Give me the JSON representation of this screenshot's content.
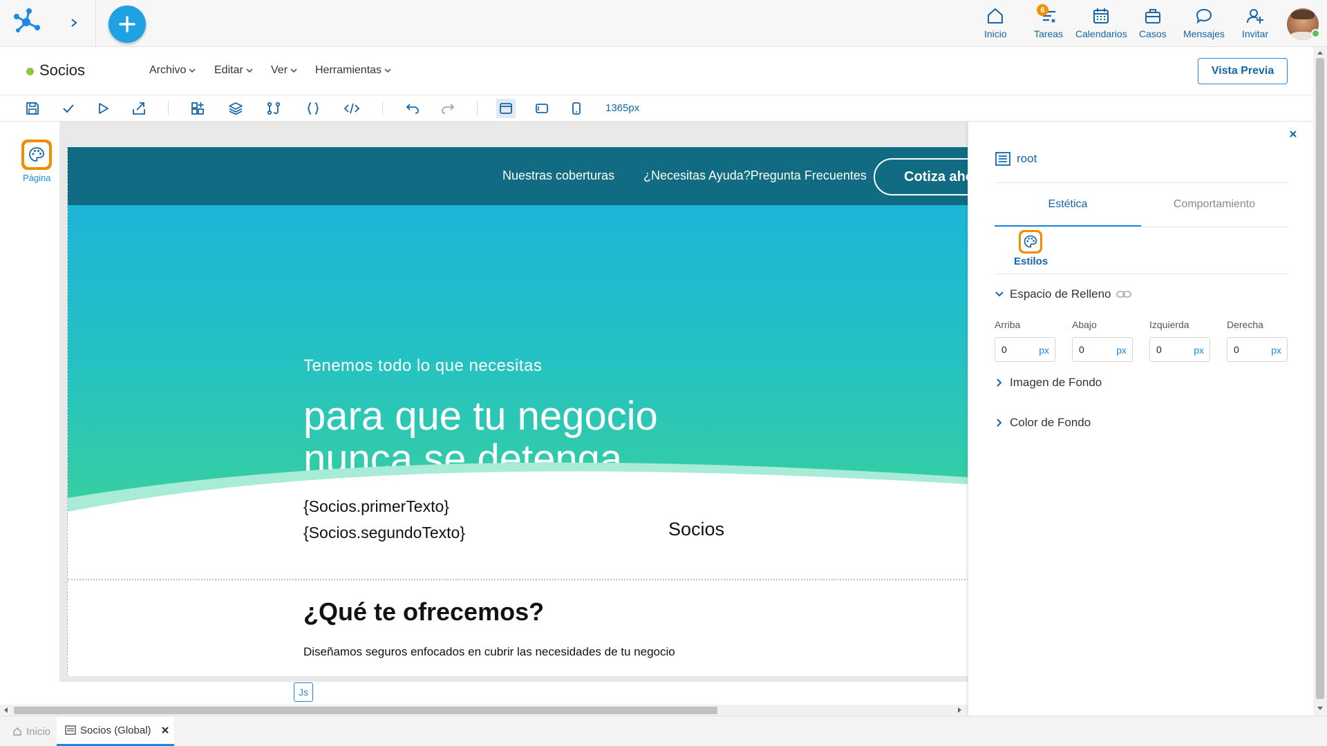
{
  "topbar": {
    "nav": [
      {
        "label": "Inicio",
        "icon": "home-icon"
      },
      {
        "label": "Tareas",
        "icon": "tasks-icon",
        "badge": "6"
      },
      {
        "label": "Calendarios",
        "icon": "calendar-icon"
      },
      {
        "label": "Casos",
        "icon": "briefcase-icon"
      },
      {
        "label": "Mensajes",
        "icon": "chat-icon"
      },
      {
        "label": "Invitar",
        "icon": "add-user-icon"
      }
    ],
    "accent": "#1ea2e4",
    "badge_color": "#f39200"
  },
  "menubar": {
    "title": "Socios",
    "status_color": "#8cc63f",
    "menus": [
      "Archivo",
      "Editar",
      "Ver",
      "Herramientas"
    ],
    "preview_label": "Vista Previa"
  },
  "toolbar": {
    "width_label": "1365px"
  },
  "left_strip": {
    "page_label": "Página"
  },
  "canvas": {
    "nav_links": [
      "Nuestras coberturas",
      "¿Necesitas Ayuda?Pregunta Frecuentes"
    ],
    "cta_label": "Cotiza ahora",
    "hero_subtitle": "Tenemos todo lo que necesitas",
    "hero_title_line1": "para que tu negocio",
    "hero_title_line2": "nunca se detenga",
    "var_text_1": "{Socios.primerTexto}",
    "var_text_2": "{Socios.segundoTexto}",
    "socios_label": "Socios",
    "offer_title": "¿Qué te ofrecemos?",
    "offer_desc": "Diseñamos seguros enfocados en cubrir las necesidades de tu negocio",
    "js_label": "Js",
    "nav_color": "#116b82"
  },
  "panel": {
    "root_label": "root",
    "tabs": [
      "Estética",
      "Comportamiento"
    ],
    "styles_label": "Estilos",
    "padding_section": "Espacio de Relleno",
    "padding_fields": [
      {
        "label": "Arriba",
        "value": "0",
        "unit": "px"
      },
      {
        "label": "Abajo",
        "value": "0",
        "unit": "px"
      },
      {
        "label": "Izquierda",
        "value": "0",
        "unit": "px"
      },
      {
        "label": "Derecha",
        "value": "0",
        "unit": "px"
      }
    ],
    "bg_image_section": "Imagen de Fondo",
    "bg_color_section": "Color de Fondo"
  },
  "bottom_tabs": [
    {
      "label": "Inicio",
      "icon": "home-icon"
    },
    {
      "label": "Socios (Global)",
      "icon": "form-icon"
    }
  ]
}
